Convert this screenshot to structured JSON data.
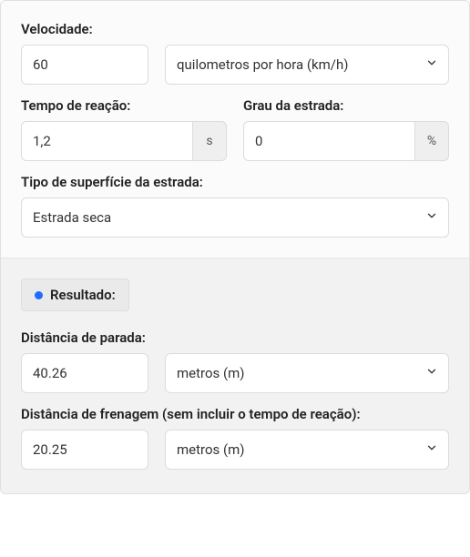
{
  "speed": {
    "label": "Velocidade:",
    "value": "60",
    "unit_selected": "quilometros por hora (km/h)"
  },
  "reaction": {
    "label": "Tempo de reação:",
    "value": "1,2",
    "unit": "s"
  },
  "grade": {
    "label": "Grau da estrada:",
    "value": "0",
    "unit": "%"
  },
  "surface": {
    "label": "Tipo de superfície da estrada:",
    "selected": "Estrada seca"
  },
  "result": {
    "heading": "Resultado:",
    "stop_label": "Distância de parada:",
    "stop_value": "40.26",
    "stop_unit_selected": "metros (m)",
    "brake_label": "Distância de frenagem (sem incluir o tempo de reação):",
    "brake_value": "20.25",
    "brake_unit_selected": "metros (m)"
  }
}
